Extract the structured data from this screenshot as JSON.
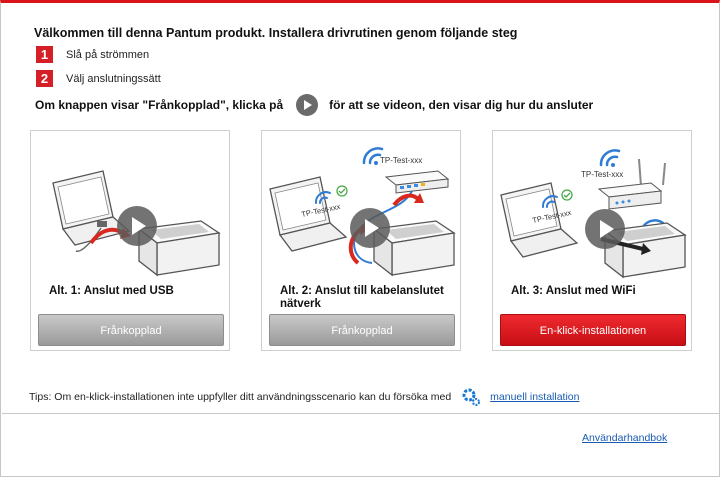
{
  "header": {
    "welcome": "Välkommen till denna Pantum produkt. Installera drivrutinen genom följande steg",
    "steps": [
      {
        "num": "1",
        "text": "Slå på strömmen"
      },
      {
        "num": "2",
        "text": "Välj anslutningssätt"
      }
    ],
    "hint_before": "Om knappen visar \"Frånkopplad\", klicka på",
    "hint_after": "för att se videon, den visar dig hur du ansluter"
  },
  "cards": [
    {
      "title": "Alt. 1: Anslut med USB",
      "button": "Frånkopplad",
      "status": "gray"
    },
    {
      "title": "Alt. 2: Anslut till kabelanslutet nätverk",
      "button": "Frånkopplad",
      "status": "gray",
      "ssid": "TP-Test-xxx"
    },
    {
      "title": "Alt. 3: Anslut med WiFi",
      "button": "En-klick-installationen",
      "status": "red",
      "ssid": "TP-Test-xxx"
    }
  ],
  "footer": {
    "tips": "Tips: Om en-klick-installationen inte uppfyller ditt användningsscenario kan du försöka med",
    "manual_install": "manuell installation",
    "user_manual": "Användarhandbok"
  },
  "colors": {
    "accent": "#d51f26",
    "link": "#1a5cb0"
  },
  "icons": [
    "play-icon",
    "gear-icon",
    "wifi-icon",
    "check-icon"
  ]
}
